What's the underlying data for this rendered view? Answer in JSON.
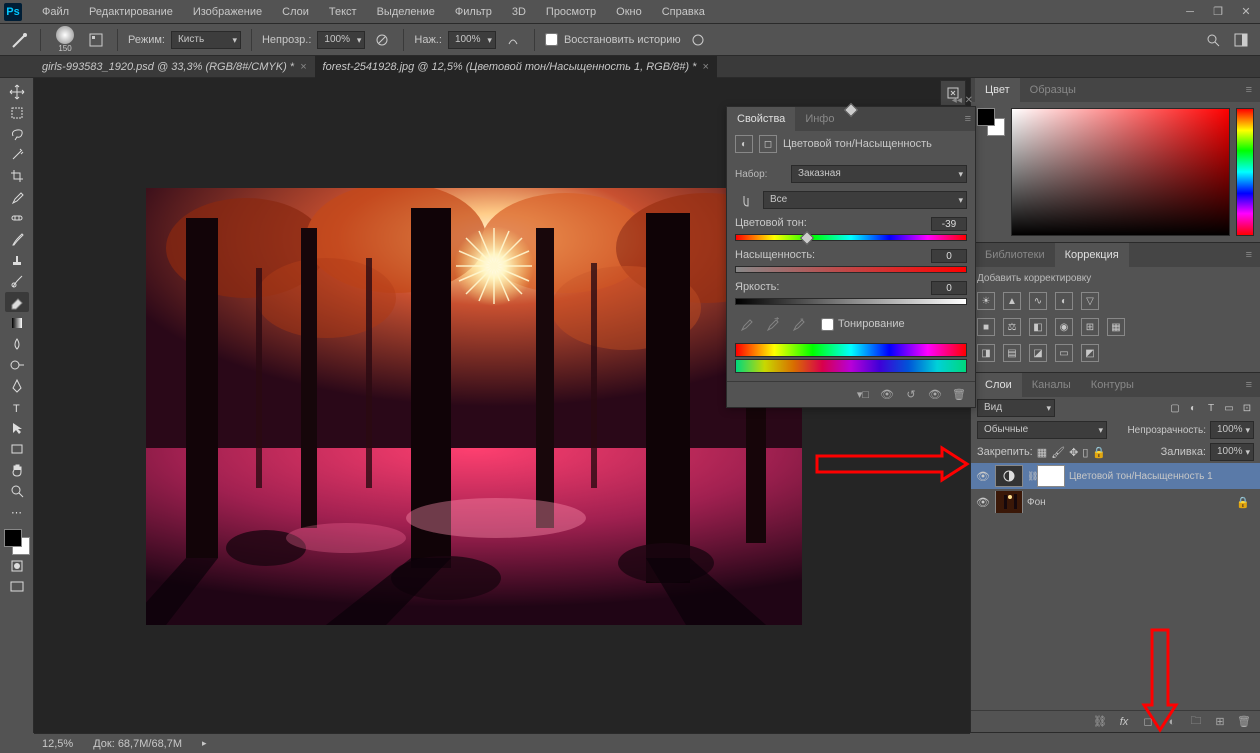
{
  "app": {
    "name": "Ps"
  },
  "menu": [
    "Файл",
    "Редактирование",
    "Изображение",
    "Слои",
    "Текст",
    "Выделение",
    "Фильтр",
    "3D",
    "Просмотр",
    "Окно",
    "Справка"
  ],
  "optbar": {
    "mode_label": "Режим:",
    "mode_value": "Кисть",
    "opacity_label": "Непрозр.:",
    "opacity_value": "100%",
    "flow_label": "Наж.:",
    "flow_value": "100%",
    "restore_label": "Восстановить историю",
    "brush_size": "150"
  },
  "tabs": [
    {
      "title": "girls-993583_1920.psd @ 33,3% (RGB/8#/CMYK) *",
      "active": false
    },
    {
      "title": "forest-2541928.jpg @ 12,5% (Цветовой тон/Насыщенность 1, RGB/8#) *",
      "active": true
    }
  ],
  "status": {
    "zoom": "12,5%",
    "doc": "Док: 68,7M/68,7M"
  },
  "panel_color": {
    "tab1": "Цвет",
    "tab2": "Образцы"
  },
  "panel_lib": {
    "tab1": "Библиотеки",
    "tab2": "Коррекция",
    "add": "Добавить корректировку"
  },
  "panel_layers": {
    "tab1": "Слои",
    "tab2": "Каналы",
    "tab3": "Контуры",
    "kind": "Вид",
    "blend": "Обычные",
    "opacity_label": "Непрозрачность:",
    "opacity": "100%",
    "lock_label": "Закрепить:",
    "fill_label": "Заливка:",
    "fill": "100%",
    "layer1": "Цветовой тон/Насыщенность 1",
    "layer2": "Фон"
  },
  "props": {
    "tab1": "Свойства",
    "tab2": "Инфо",
    "title": "Цветовой тон/Насыщенность",
    "preset_label": "Набор:",
    "preset_value": "Заказная",
    "range_value": "Все",
    "hue_label": "Цветовой тон:",
    "hue_value": "-39",
    "sat_label": "Насыщенность:",
    "sat_value": "0",
    "lig_label": "Яркость:",
    "lig_value": "0",
    "colorize": "Тонирование"
  }
}
